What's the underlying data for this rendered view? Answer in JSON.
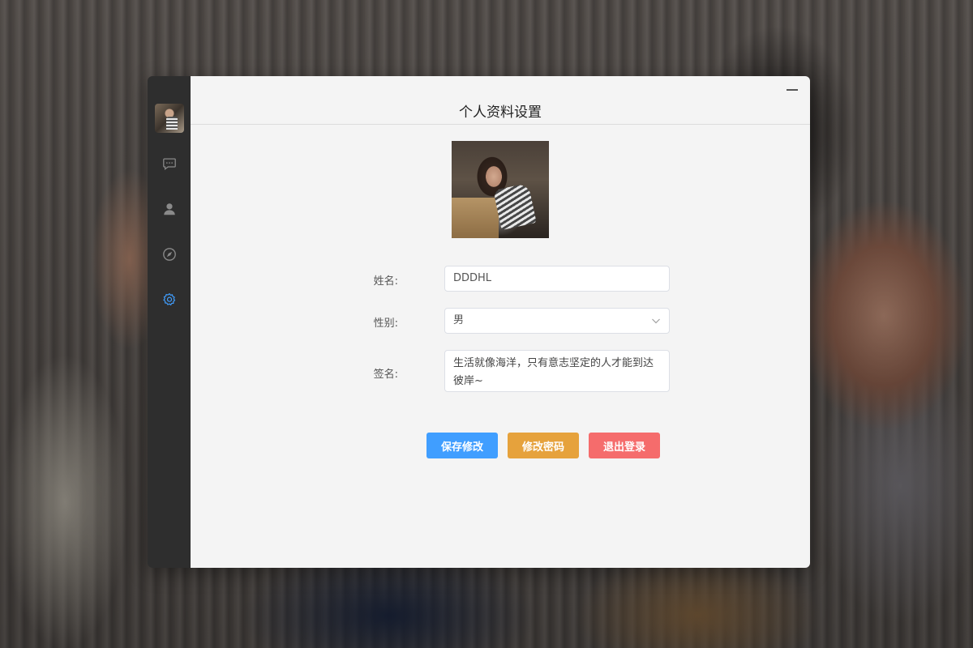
{
  "window": {
    "title": "个人资料设置",
    "controls": [
      "minimize-icon",
      "fullscreen-icon",
      "close-icon"
    ]
  },
  "sidebar": {
    "items": [
      {
        "name": "chat",
        "icon": "chat-bubble-icon"
      },
      {
        "name": "contacts",
        "icon": "user-icon"
      },
      {
        "name": "discover",
        "icon": "compass-icon"
      },
      {
        "name": "settings",
        "icon": "gear-icon",
        "active": true
      }
    ],
    "active_color": "#409eff",
    "inactive_color": "#8a8a8a"
  },
  "form": {
    "name_label": "姓名:",
    "name_value": "DDDHL",
    "gender_label": "性别:",
    "gender_value": "男",
    "signature_label": "签名:",
    "signature_value": "生活就像海洋，只有意志坚定的人才能到达彼岸~"
  },
  "buttons": {
    "save": {
      "label": "保存修改",
      "color": "#409eff"
    },
    "change_password": {
      "label": "修改密码",
      "color": "#e6a23c"
    },
    "logout": {
      "label": "退出登录",
      "color": "#f56c6c"
    }
  }
}
